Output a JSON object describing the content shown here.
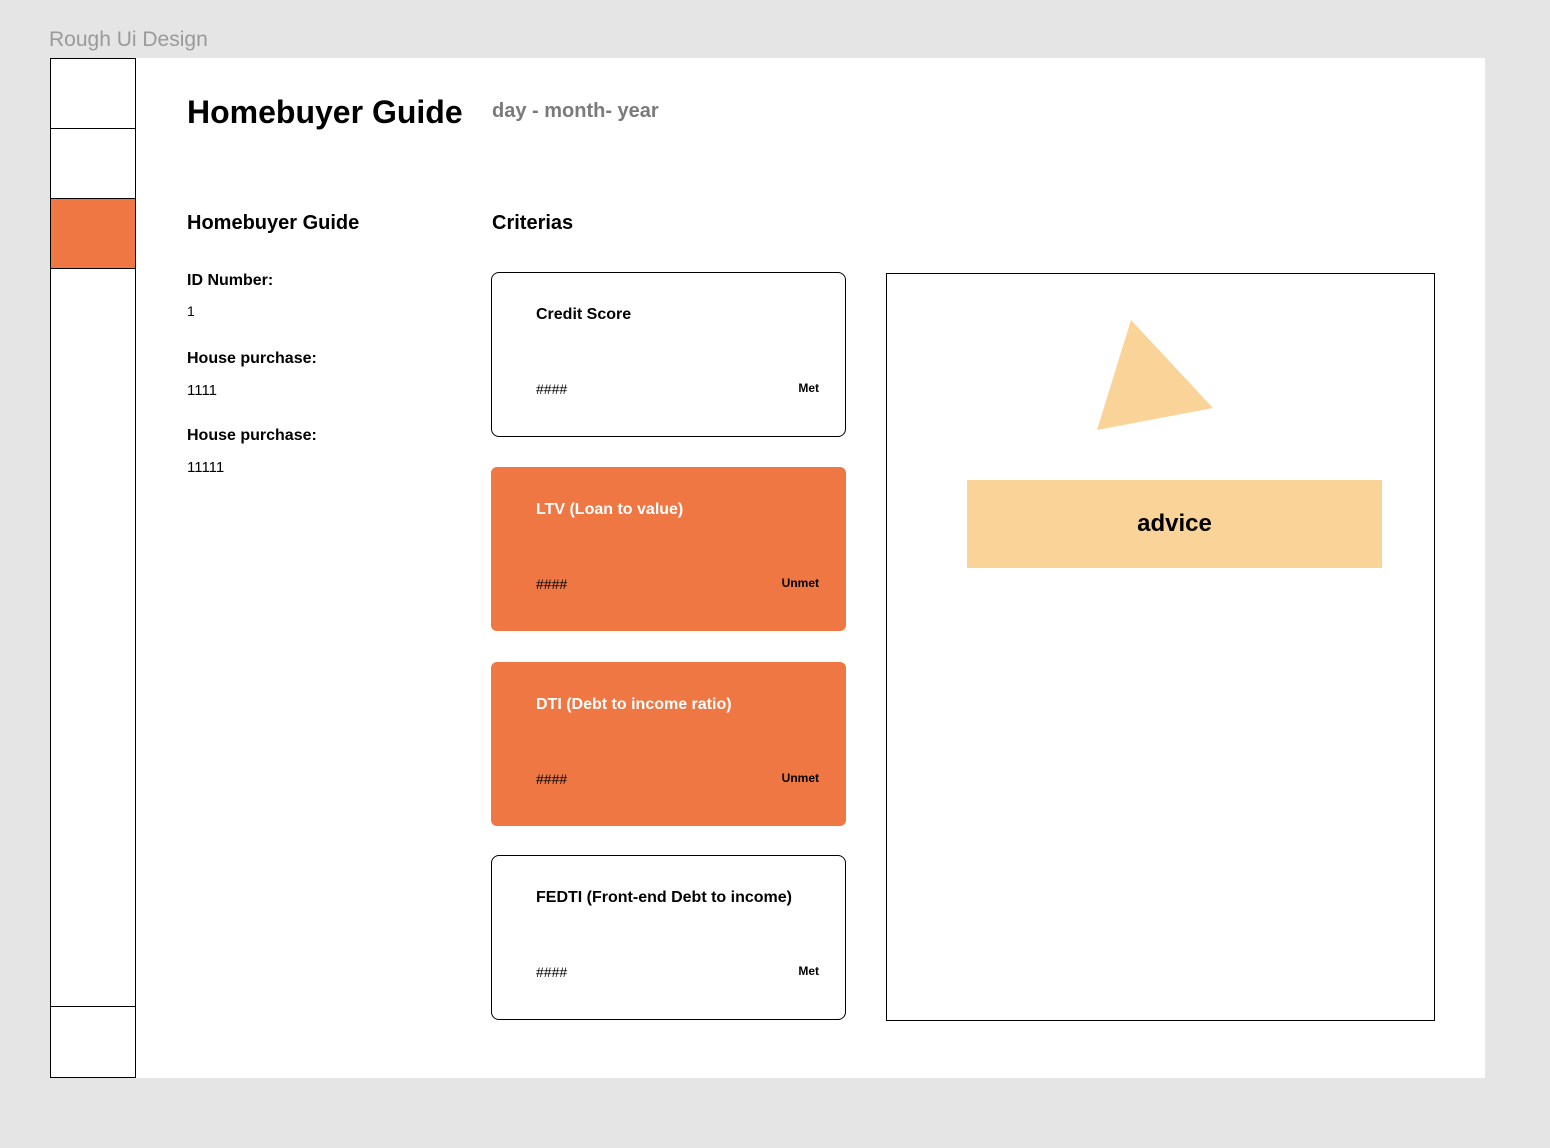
{
  "frame_label": "Rough Ui Design",
  "header": {
    "title": "Homebuyer Guide",
    "date": "day - month- year"
  },
  "info": {
    "title": "Homebuyer Guide",
    "fields": [
      {
        "label": "ID Number:",
        "value": "1"
      },
      {
        "label": "House purchase:",
        "value": "1111"
      },
      {
        "label": "House purchase:",
        "value": "11111"
      }
    ]
  },
  "criteria": {
    "title": "Criterias",
    "cards": [
      {
        "title": "Credit Score",
        "value": "####",
        "status": "Met"
      },
      {
        "title": "LTV (Loan to value)",
        "value": "####",
        "status": "Unmet"
      },
      {
        "title": "DTI (Debt to income ratio)",
        "value": "####",
        "status": "Unmet"
      },
      {
        "title": "FEDTI (Front-end Debt to income)",
        "value": "####",
        "status": "Met"
      }
    ]
  },
  "advice": {
    "button_label": "advice",
    "icon": "triangle-icon"
  },
  "colors": {
    "accent": "#ee7744",
    "advice": "#fad399",
    "muted": "#7a7a7a"
  }
}
